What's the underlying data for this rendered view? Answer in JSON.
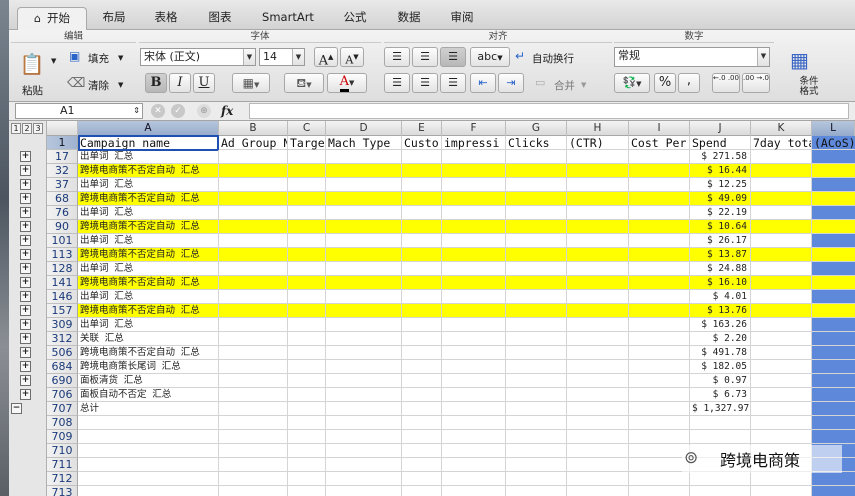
{
  "ribbon_tabs": [
    {
      "label": "开始",
      "active": true
    },
    {
      "label": "布局"
    },
    {
      "label": "表格"
    },
    {
      "label": "图表"
    },
    {
      "label": "SmartArt"
    },
    {
      "label": "公式"
    },
    {
      "label": "数据"
    },
    {
      "label": "审阅"
    }
  ],
  "ribbon": {
    "groups": {
      "edit": "编辑",
      "font": "字体",
      "align": "对齐",
      "number": "数字"
    },
    "paste": "粘贴",
    "fill": "填充",
    "clear": "清除",
    "font_name": "宋体 (正文)",
    "font_size": "14",
    "bold": "B",
    "italic": "I",
    "underline": "U",
    "grow_font": "A",
    "shrink_font": "A",
    "font_color": "A",
    "abc": "abc",
    "wrap_text": "自动换行",
    "merge": "合并",
    "number_format": "常规",
    "percent": "%",
    "comma": ",",
    "dec_inc": "←.0 .00",
    "dec_dec": ".00 →.0",
    "cond_format": "条件格式"
  },
  "formula_bar": {
    "name_box": "A1",
    "fx": "fx",
    "value": ""
  },
  "sheet": {
    "outline_levels": [
      "1",
      "2",
      "3"
    ],
    "columns": [
      "A",
      "B",
      "C",
      "D",
      "E",
      "F",
      "G",
      "H",
      "I",
      "J",
      "K",
      "L"
    ],
    "headers": [
      "Campaign name",
      "Ad Group N",
      "Targe",
      "Mach Type",
      "Custo",
      "impressi",
      "Clicks",
      "(CTR)",
      "Cost Per",
      "Spend",
      "7day tota",
      "(ACoS)"
    ],
    "rows": [
      {
        "num": "17",
        "name": "出单词 汇总",
        "spend": "$ 271.58",
        "yellow": false
      },
      {
        "num": "32",
        "name": "跨境电商策不否定自动 汇总",
        "spend": "$ 16.44",
        "yellow": true
      },
      {
        "num": "37",
        "name": "出单词 汇总",
        "spend": "$ 12.25",
        "yellow": false
      },
      {
        "num": "68",
        "name": "跨境电商策不否定自动 汇总",
        "spend": "$ 49.09",
        "yellow": true
      },
      {
        "num": "76",
        "name": "出单词 汇总",
        "spend": "$ 22.19",
        "yellow": false
      },
      {
        "num": "90",
        "name": "跨境电商策不否定自动 汇总",
        "spend": "$ 10.64",
        "yellow": true
      },
      {
        "num": "101",
        "name": "出单词 汇总",
        "spend": "$ 26.17",
        "yellow": false
      },
      {
        "num": "113",
        "name": "跨境电商策不否定自动 汇总",
        "spend": "$ 13.87",
        "yellow": true
      },
      {
        "num": "128",
        "name": "出单词 汇总",
        "spend": "$ 24.88",
        "yellow": false
      },
      {
        "num": "141",
        "name": "跨境电商策不否定自动 汇总",
        "spend": "$ 16.10",
        "yellow": true
      },
      {
        "num": "146",
        "name": "出单词 汇总",
        "spend": "$ 4.01",
        "yellow": false
      },
      {
        "num": "157",
        "name": "跨境电商策不否定自动 汇总",
        "spend": "$ 13.76",
        "yellow": true
      },
      {
        "num": "309",
        "name": "出单词 汇总",
        "spend": "$ 163.26",
        "yellow": false
      },
      {
        "num": "312",
        "name": "关联 汇总",
        "spend": "$ 2.20",
        "yellow": false
      },
      {
        "num": "506",
        "name": "跨境电商策不否定自动 汇总",
        "spend": "$ 491.78",
        "yellow": false
      },
      {
        "num": "684",
        "name": "跨境电商策长尾词 汇总",
        "spend": "$ 182.05",
        "yellow": false
      },
      {
        "num": "690",
        "name": "面板清货 汇总",
        "spend": "$ 0.97",
        "yellow": false
      },
      {
        "num": "706",
        "name": "面板自动不否定 汇总",
        "spend": "$ 6.73",
        "yellow": false
      },
      {
        "num": "707",
        "name": "总计",
        "spend": "$ 1,327.97",
        "yellow": false
      },
      {
        "num": "708",
        "name": "",
        "spend": "",
        "yellow": false
      },
      {
        "num": "709",
        "name": "",
        "spend": "",
        "yellow": false
      },
      {
        "num": "710",
        "name": "",
        "spend": "",
        "yellow": false
      },
      {
        "num": "711",
        "name": "",
        "spend": "",
        "yellow": false
      },
      {
        "num": "712",
        "name": "",
        "spend": "",
        "yellow": false
      },
      {
        "num": "713",
        "name": "",
        "spend": "",
        "yellow": false
      }
    ]
  },
  "watermark": "跨境电商策",
  "colors": {
    "highlight": "#ffff00",
    "selected_column": "#5e88d9"
  }
}
